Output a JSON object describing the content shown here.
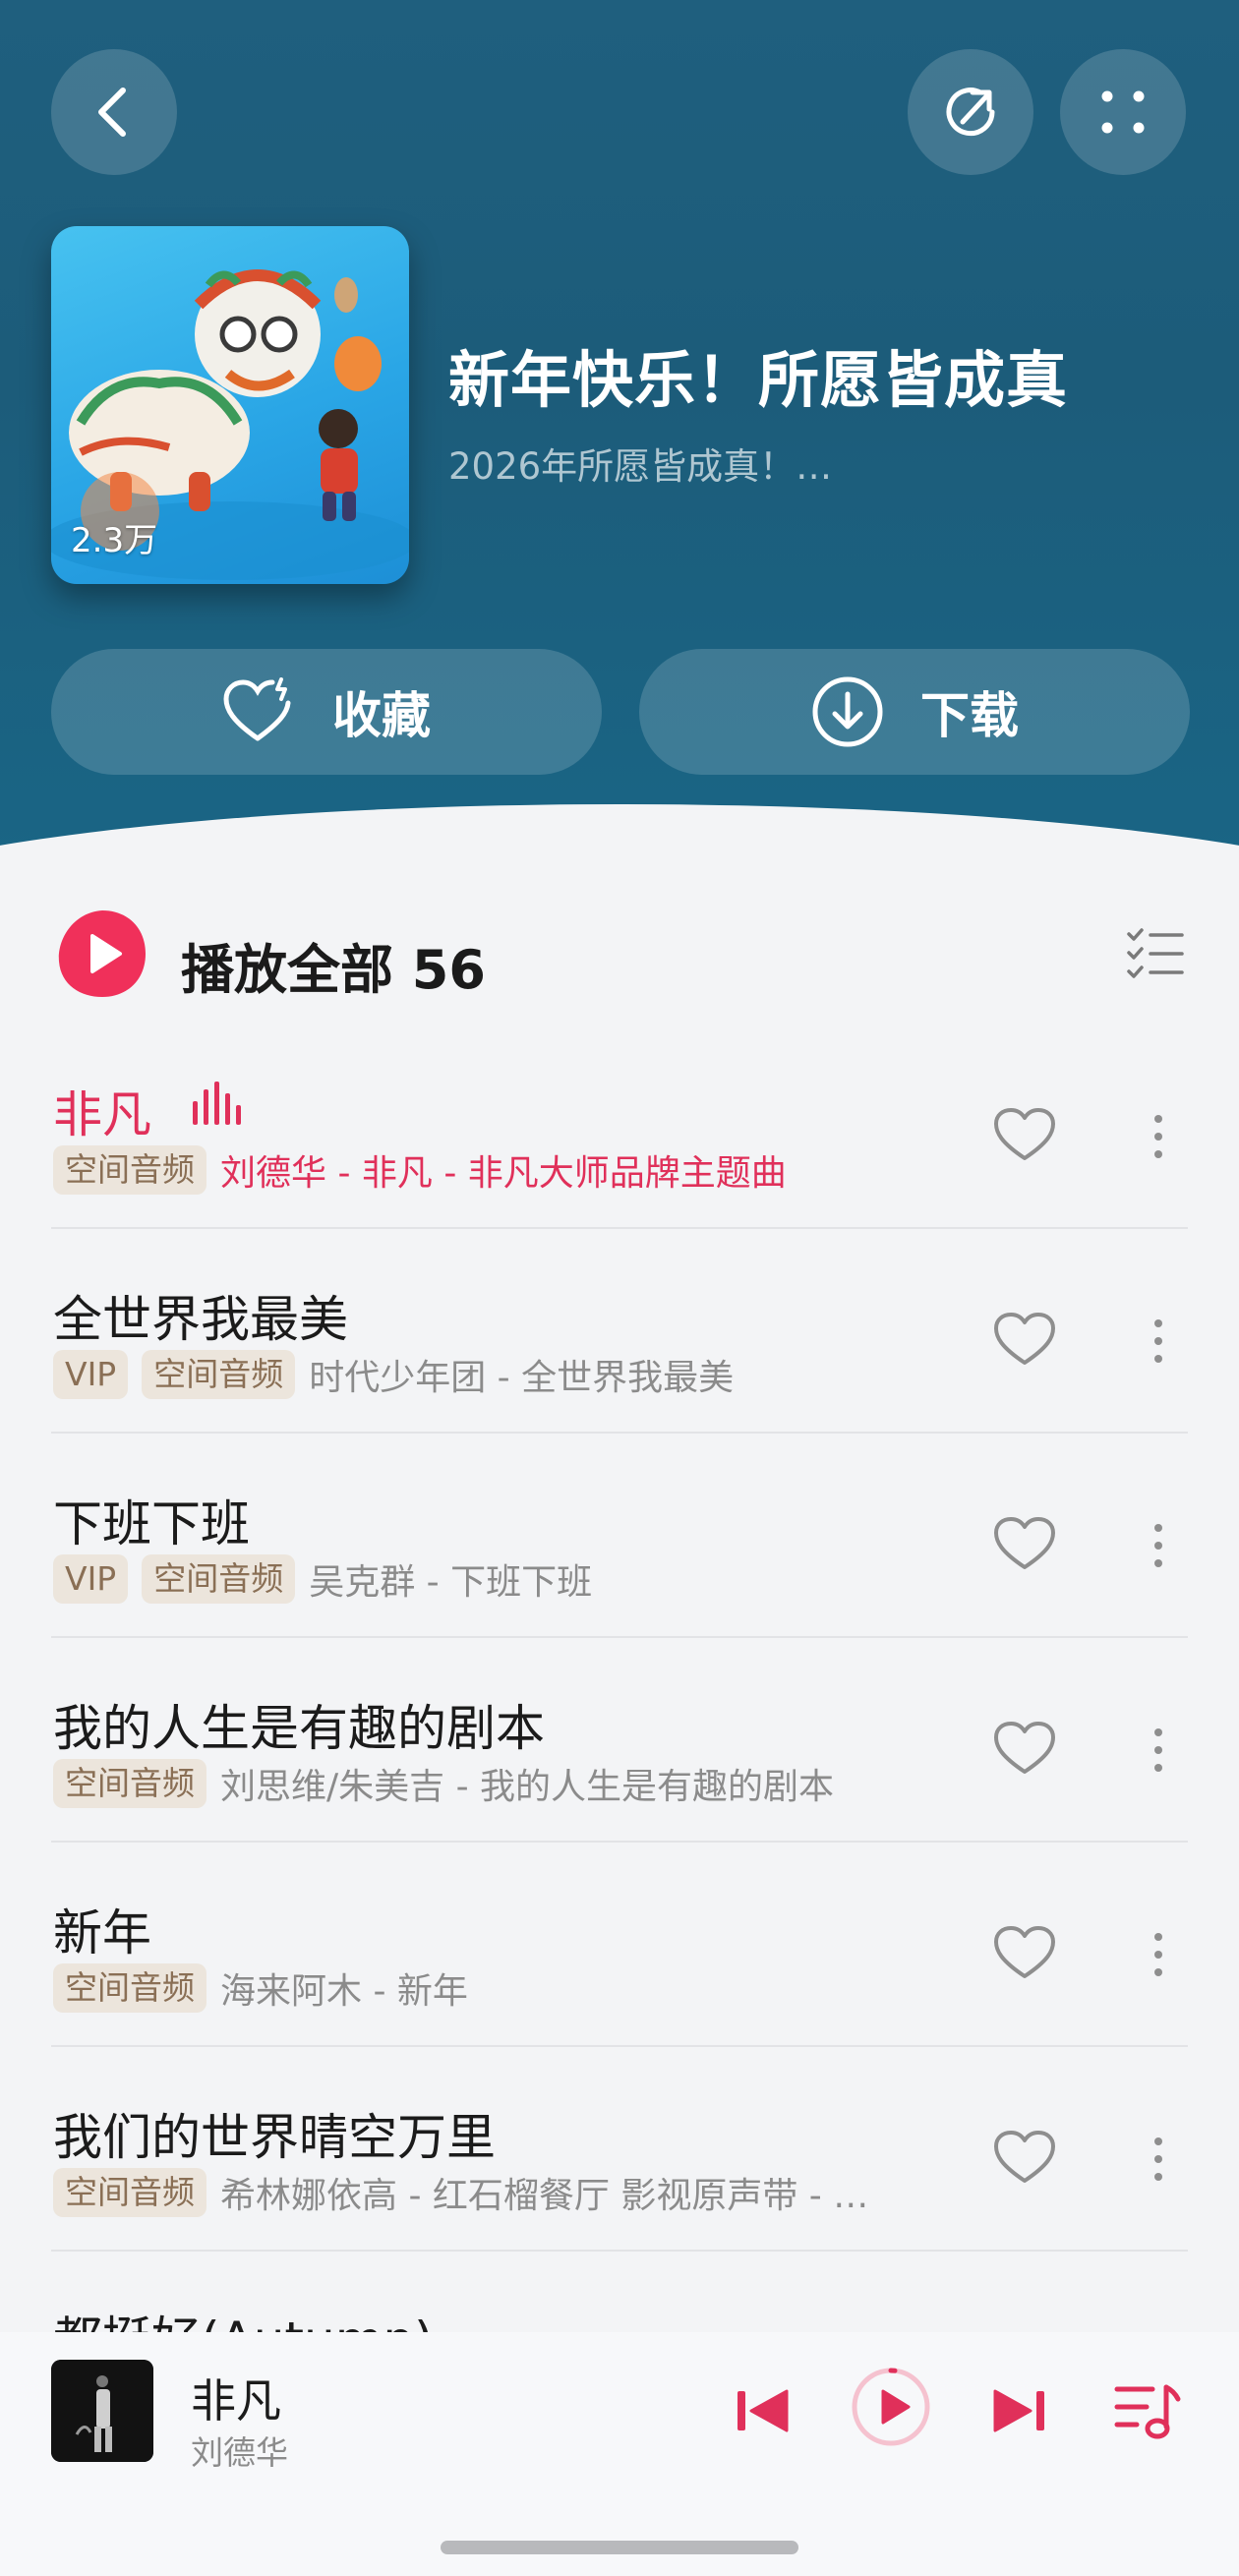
{
  "header": {
    "back_icon": "chevron-left-icon",
    "share_icon": "share-icon",
    "more_icon": "more-grid-icon",
    "cover_play_count": "2.3万",
    "title": "新年快乐！所愿皆成真",
    "subtitle": "2026年所愿皆成真！…",
    "favorite_label": "收藏",
    "download_label": "下载"
  },
  "list_header": {
    "play_all_label": "播放全部 56"
  },
  "songs": [
    {
      "title": "非凡",
      "tags": [
        "空间音频"
      ],
      "meta": "刘德华 - 非凡 - 非凡大师品牌主题曲",
      "playing": true
    },
    {
      "title": "全世界我最美",
      "tags": [
        "VIP",
        "空间音频"
      ],
      "meta": "时代少年团 - 全世界我最美",
      "playing": false
    },
    {
      "title": "下班下班",
      "tags": [
        "VIP",
        "空间音频"
      ],
      "meta": "吴克群 - 下班下班",
      "playing": false
    },
    {
      "title": "我的人生是有趣的剧本",
      "tags": [
        "空间音频"
      ],
      "meta": "刘思维/朱美吉 - 我的人生是有趣的剧本",
      "playing": false
    },
    {
      "title": "新年",
      "tags": [
        "空间音频"
      ],
      "meta": "海来阿木 - 新年",
      "playing": false
    },
    {
      "title": "我们的世界晴空万里",
      "tags": [
        "空间音频"
      ],
      "meta": "希林娜依高 - 红石榴餐厅 影视原声带 - …",
      "playing": false
    }
  ],
  "partial_song": "都挺好(Autumn)",
  "player": {
    "title": "非凡",
    "artist": "刘德华"
  },
  "colors": {
    "accent": "#e0305a",
    "header_bg": "#1f5f7e",
    "tag_bg": "#ece5dc",
    "tag_text": "#8a6f55"
  }
}
